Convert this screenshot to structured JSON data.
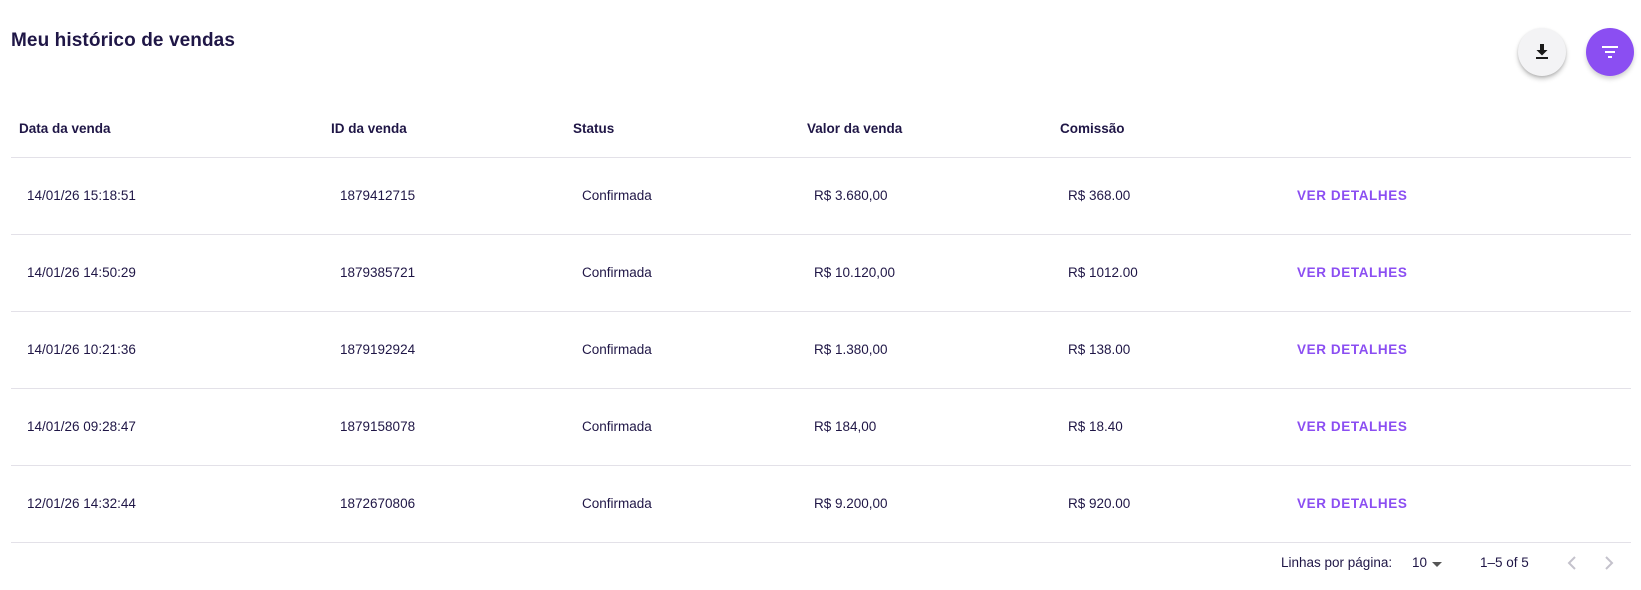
{
  "page": {
    "title": "Meu histórico de vendas"
  },
  "actions": {
    "download_icon": "download-icon",
    "filter_icon": "filter-icon",
    "accent_color": "#8b4ef2"
  },
  "table": {
    "headers": [
      "Data da venda",
      "ID da venda",
      "Status",
      "Valor da venda",
      "Comissão"
    ],
    "rows": [
      {
        "date": "14/01/26 15:18:51",
        "id": "1879412715",
        "status": "Confirmada",
        "value": "R$ 3.680,00",
        "commission": "R$ 368.00",
        "action": "VER DETALHES"
      },
      {
        "date": "14/01/26 14:50:29",
        "id": "1879385721",
        "status": "Confirmada",
        "value": "R$ 10.120,00",
        "commission": "R$ 1012.00",
        "action": "VER DETALHES"
      },
      {
        "date": "14/01/26 10:21:36",
        "id": "1879192924",
        "status": "Confirmada",
        "value": "R$ 1.380,00",
        "commission": "R$ 138.00",
        "action": "VER DETALHES"
      },
      {
        "date": "14/01/26 09:28:47",
        "id": "1879158078",
        "status": "Confirmada",
        "value": "R$ 184,00",
        "commission": "R$ 18.40",
        "action": "VER DETALHES"
      },
      {
        "date": "12/01/26 14:32:44",
        "id": "1872670806",
        "status": "Confirmada",
        "value": "R$ 9.200,00",
        "commission": "R$ 920.00",
        "action": "VER DETALHES"
      }
    ]
  },
  "pagination": {
    "rows_per_page_label": "Linhas por página:",
    "rows_per_page_value": "10",
    "range_text": "1–5 of 5",
    "prev_icon": "chevron-left-icon",
    "next_icon": "chevron-right-icon"
  }
}
